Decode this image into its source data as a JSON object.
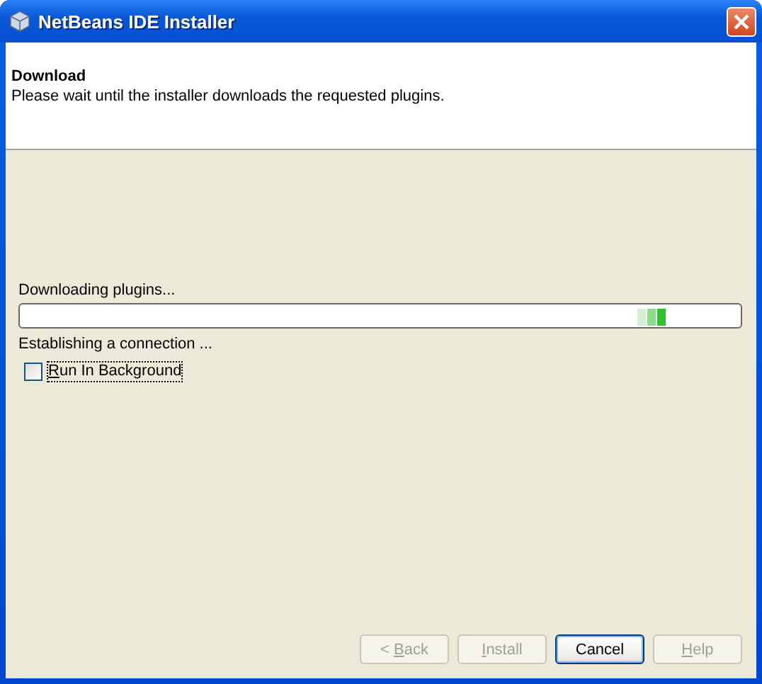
{
  "window": {
    "title": "NetBeans IDE Installer"
  },
  "header": {
    "title": "Download",
    "description": "Please wait until the installer downloads the requested plugins."
  },
  "progress": {
    "label": "Downloading plugins...",
    "status": "Establishing a connection ..."
  },
  "checkbox": {
    "mnemonic": "R",
    "text_after": "un In Background",
    "checked": false,
    "focused": true
  },
  "buttons": [
    {
      "text_before": "< ",
      "mnemonic": "B",
      "text_after": "ack",
      "disabled": true,
      "default": false
    },
    {
      "mnemonic": "I",
      "text_after": "nstall",
      "disabled": true,
      "default": false
    },
    {
      "text_before": "Cancel",
      "disabled": false,
      "default": true
    },
    {
      "mnemonic": "H",
      "text_after": "elp",
      "disabled": true,
      "default": false
    }
  ]
}
